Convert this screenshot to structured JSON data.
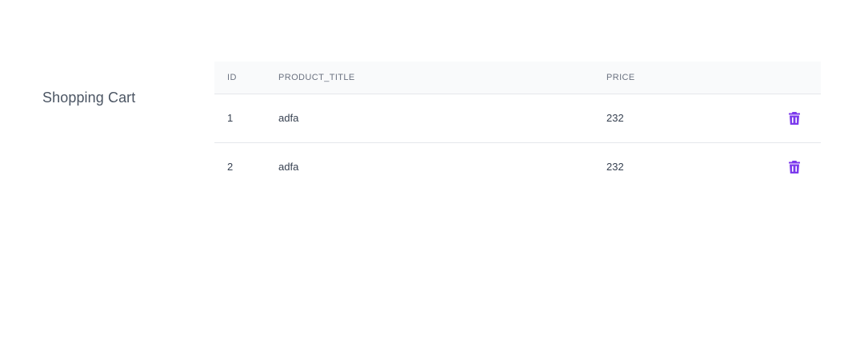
{
  "page": {
    "title": "Shopping Cart"
  },
  "table": {
    "headers": {
      "id": "ID",
      "product_title": "PRODUCT_TITLE",
      "price": "PRICE"
    },
    "rows": [
      {
        "id": "1",
        "product_title": "adfa",
        "price": "232",
        "action_icon": "trash-icon"
      },
      {
        "id": "2",
        "product_title": "adfa",
        "price": "232",
        "action_icon": "trash-icon"
      }
    ]
  },
  "colors": {
    "accent": "#7c3aed",
    "header_bg": "#f9fafb",
    "divider": "#e5e7eb"
  }
}
